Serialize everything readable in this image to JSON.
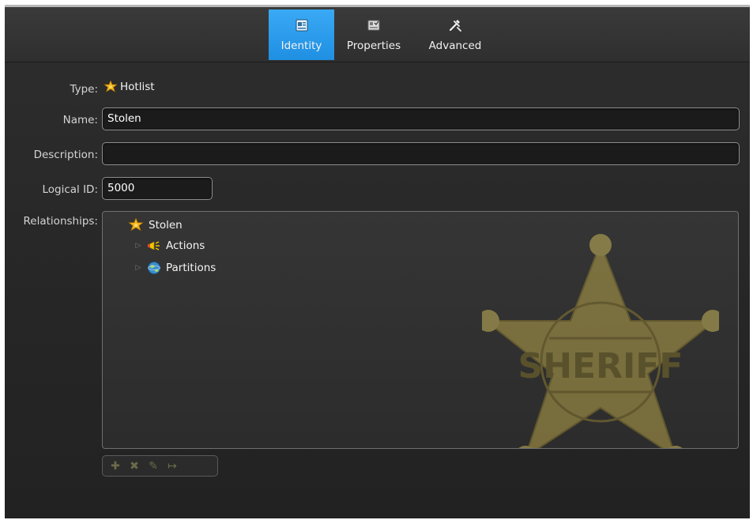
{
  "tabs": [
    {
      "label": "Identity",
      "icon": "id-card-icon",
      "active": true
    },
    {
      "label": "Properties",
      "icon": "properties-icon",
      "active": false
    },
    {
      "label": "Advanced",
      "icon": "tools-icon",
      "active": false
    }
  ],
  "form": {
    "type_label": "Type:",
    "type_value": "Hotlist",
    "name_label": "Name:",
    "name_value": "Stolen",
    "description_label": "Description:",
    "description_value": "",
    "logical_id_label": "Logical ID:",
    "logical_id_value": "5000",
    "relationships_label": "Relationships:"
  },
  "tree": {
    "root": "Stolen",
    "children": [
      "Actions",
      "Partitions"
    ]
  },
  "watermark": {
    "text": "SHERIFF"
  },
  "toolbar": {
    "buttons": [
      "add-icon",
      "delete-icon",
      "edit-icon",
      "jump-to-icon"
    ]
  },
  "colors": {
    "accent": "#2196ea",
    "background": "#262626",
    "badge_gold": "#e8b923"
  }
}
